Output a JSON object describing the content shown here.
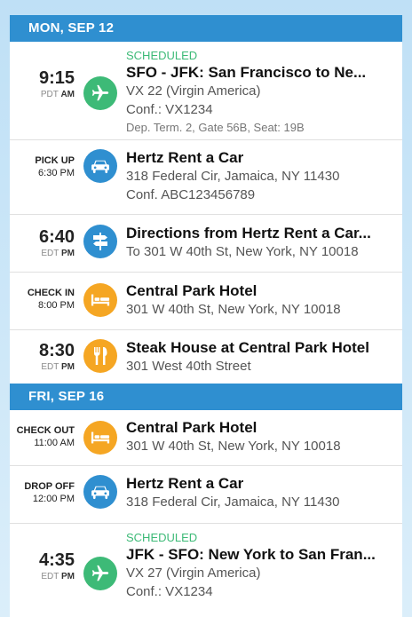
{
  "days": [
    {
      "header": "MON, SEP 12",
      "items": [
        {
          "time": "9:15",
          "tz": "PDT",
          "ampm": "AM",
          "icon": "plane-icon",
          "status": "SCHEDULED",
          "title": "SFO - JFK: San Francisco to Ne...",
          "line1": "VX 22 (Virgin America)",
          "line2": "Conf.: VX1234",
          "line3": "Dep. Term. 2, Gate 56B, Seat: 19B"
        },
        {
          "label": "PICK UP",
          "label_time": "6:30 PM",
          "icon": "car-icon",
          "title": "Hertz Rent a Car",
          "line1": "318 Federal Cir, Jamaica, NY 11430",
          "line2": "Conf. ABC123456789"
        },
        {
          "time": "6:40",
          "tz": "EDT",
          "ampm": "PM",
          "icon": "directions-signpost-icon",
          "title": "Directions from Hertz Rent a Car...",
          "line1": "To 301 W 40th St, New York, NY 10018"
        },
        {
          "label": "CHECK IN",
          "label_time": "8:00 PM",
          "icon": "bed-icon",
          "title": "Central Park Hotel",
          "line1": "301 W 40th St, New York, NY 10018"
        },
        {
          "time": "8:30",
          "tz": "EDT",
          "ampm": "PM",
          "icon": "fork-knife-icon",
          "title": "Steak House at Central Park Hotel",
          "line1": "301 West 40th Street"
        }
      ]
    },
    {
      "header": "FRI, SEP 16",
      "items": [
        {
          "label": "CHECK OUT",
          "label_time": "11:00 AM",
          "icon": "bed-icon",
          "title": "Central Park Hotel",
          "line1": "301 W 40th St, New York, NY 10018"
        },
        {
          "label": "DROP OFF",
          "label_time": "12:00 PM",
          "icon": "car-icon",
          "title": "Hertz Rent a Car",
          "line1": "318 Federal Cir, Jamaica, NY 11430"
        },
        {
          "time": "4:35",
          "tz": "EDT",
          "ampm": "PM",
          "icon": "plane-icon",
          "status": "SCHEDULED",
          "title": "JFK - SFO: New York to San Fran...",
          "line1": "VX 27 (Virgin America)",
          "line2": "Conf.: VX1234"
        }
      ]
    }
  ],
  "colors": {
    "header_blue": "#2f8fd0",
    "flight_green": "#3dba77",
    "lodging_orange": "#f5a623"
  }
}
